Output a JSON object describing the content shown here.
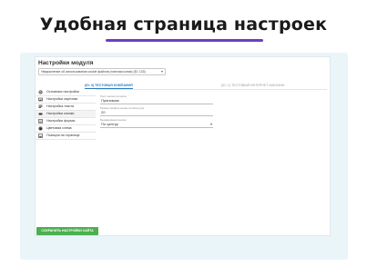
{
  "hero": {
    "title": "Удобная страница настроек"
  },
  "panel": {
    "title": "Настройки модуля",
    "module_select": "Уведомление об использовании cookie файлов (платная копия) (ID: 133)",
    "tabs": [
      {
        "label": "(ID: 0) ТЕСТОВАЯ КОМПАНИЯ",
        "active": true
      },
      {
        "label": "(ID: 1) ТЕСТОВЫЙ ИНТЕРНЕТ-МАГАЗИН",
        "active": false
      }
    ],
    "sidebar": [
      {
        "label": "Основные настройки",
        "icon": "gear-icon",
        "active": false
      },
      {
        "label": "Настройки картинки",
        "icon": "image-icon",
        "active": false
      },
      {
        "label": "Настройка текста",
        "icon": "text-icon",
        "active": false
      },
      {
        "label": "Настройки кнопки",
        "icon": "button-icon",
        "active": true
      },
      {
        "label": "Настройки формы",
        "icon": "form-icon",
        "active": false
      },
      {
        "label": "Цветовая схема",
        "icon": "palette-icon",
        "active": false
      },
      {
        "label": "Позиция на странице",
        "icon": "position-icon",
        "active": false
      }
    ],
    "form": {
      "button_text_label": "Текст кнопки согласия",
      "button_text_value": "Принимаю",
      "font_size_label": "Размер шрифта кнопки согласия (px)",
      "font_size_value": "20",
      "align_label": "Выравнивание кнопки",
      "align_value": "По центру"
    },
    "save_label": "СОХРАНИТЬ НАСТРОЙКИ САЙТА"
  },
  "colors": {
    "accent_underline": "#6b3fbf",
    "active_tab": "#2b7bbd",
    "save_button": "#4caf50",
    "backdrop": "#eaf5fa"
  }
}
